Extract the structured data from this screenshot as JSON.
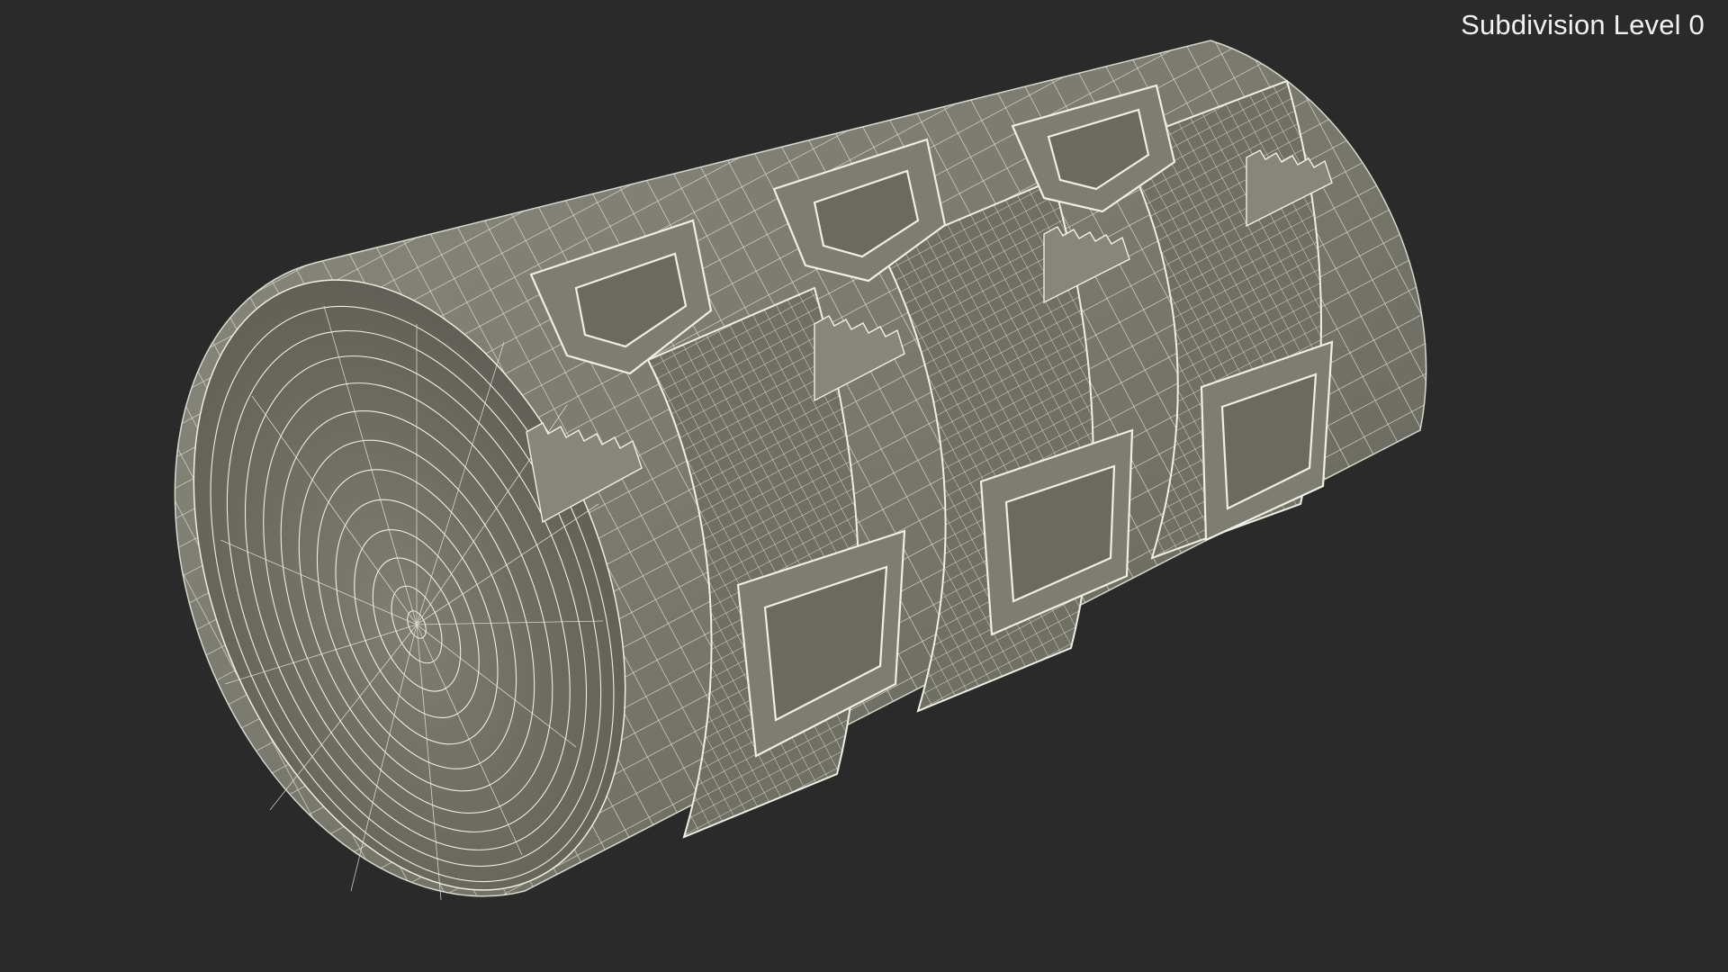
{
  "viewport": {
    "label": "Subdivision Level 0",
    "background_color": "#2a2a2a",
    "model_color": "#7a7a6e",
    "wire_color": "#f0efe6"
  },
  "model": {
    "subject": "elastic bandage roll with clips",
    "display_mode": "wireframe on shaded",
    "clip_icons": [
      "clip-icon",
      "clip-icon",
      "clip-icon",
      "clip-icon",
      "clip-icon",
      "clip-icon"
    ]
  }
}
